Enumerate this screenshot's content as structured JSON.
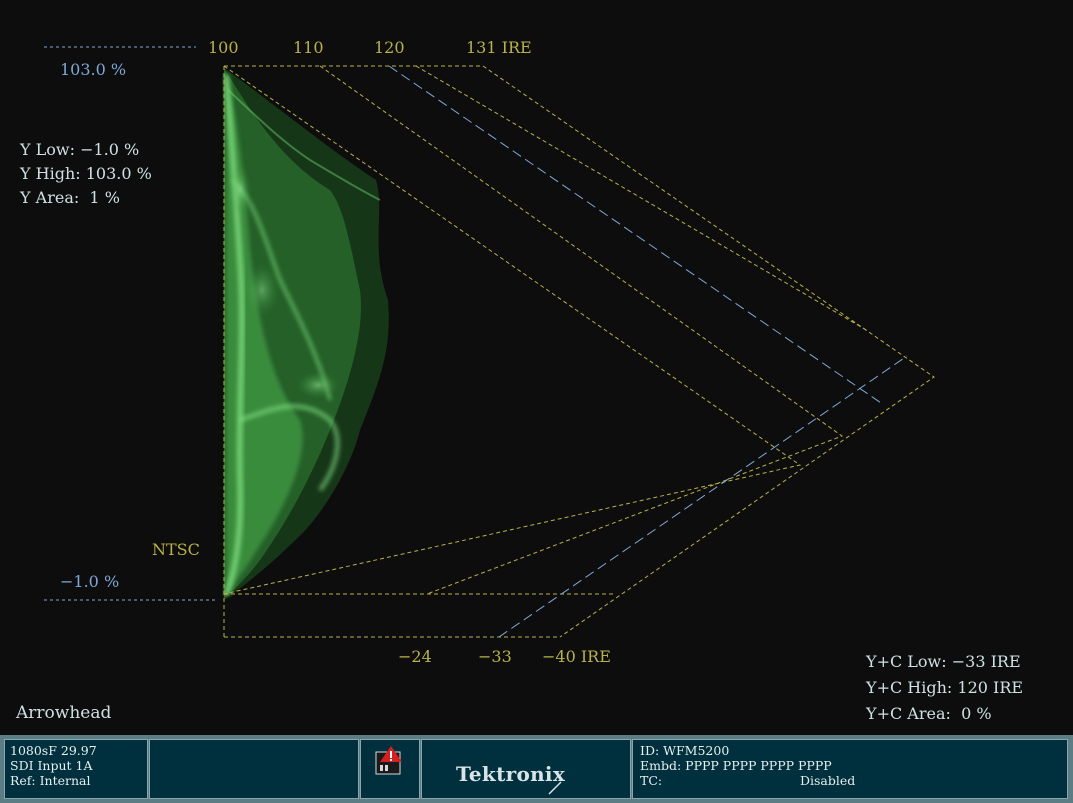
{
  "display": {
    "mode_name": "Arrowhead",
    "standard_label": "NTSC",
    "top_scale": {
      "tick_100": "100",
      "tick_110": "110",
      "tick_120": "120",
      "tick_131": "131 IRE"
    },
    "bottom_scale": {
      "tick_24": "−24",
      "tick_33": "−33",
      "tick_40": "−40 IRE"
    },
    "upper_limit": "103.0 %",
    "lower_limit": "−1.0 %",
    "luma_readout": {
      "low": "Y Low: −1.0 %",
      "high": "Y High: 103.0 %",
      "area": "Y Area:  1 %"
    },
    "composite_readout": {
      "low": "Y+C Low: −33 IRE",
      "high": "Y+C High: 120 IRE",
      "area": "Y+C Area:  0 %"
    },
    "colors": {
      "graticule": "#b9b14a",
      "limit": "#7fa7d6",
      "trace": "#5fd35f",
      "readout": "#cfe0e3"
    }
  },
  "status": {
    "format": "1080sF 29.97",
    "input": "SDI Input 1A",
    "reference": "Ref: Internal",
    "alarm_icon": "alarm-warning-icon",
    "brand": "Tektronix",
    "id": "ID: WFM5200",
    "embedded": "Embd: PPPP PPPP PPPP PPPP",
    "tc_label": "TC:",
    "tc_value": "Disabled",
    "colors": {
      "bar": "#5d7d84",
      "panel": "#00303e"
    }
  }
}
